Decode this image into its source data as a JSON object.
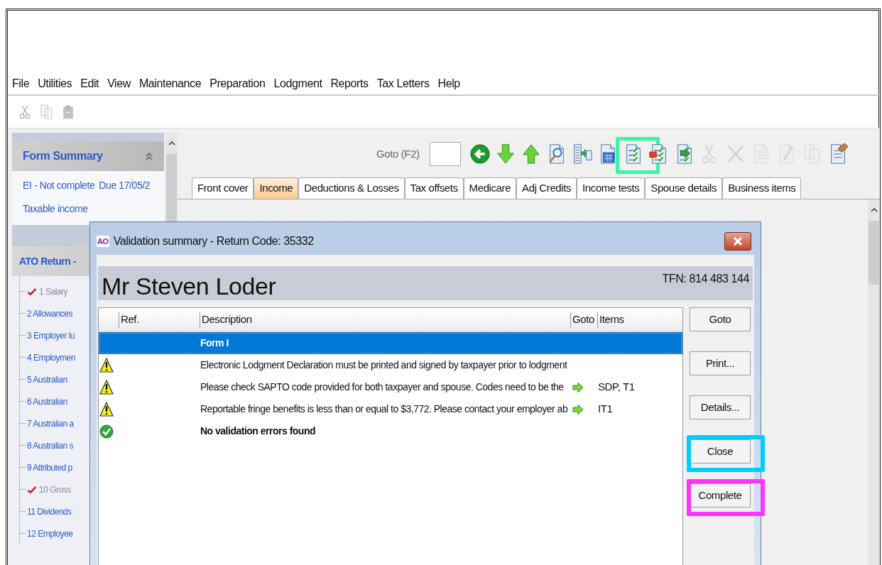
{
  "menu": [
    "File",
    "Utilities",
    "Edit",
    "View",
    "Maintenance",
    "Preparation",
    "Lodgment",
    "Reports",
    "Tax Letters",
    "Help"
  ],
  "edit_toolbar": [
    {
      "kind": "cut"
    },
    {
      "kind": "copy"
    },
    {
      "kind": "paste"
    }
  ],
  "sidebar": {
    "form_summary": {
      "title": "Form Summary",
      "status": "EI - Not complete",
      "due": "Due 17/05/2",
      "items": [
        "Taxable income"
      ]
    },
    "ato_return": {
      "title": "ATO Return -",
      "items": [
        {
          "label": "1 Salary",
          "checked": true
        },
        {
          "label": "2 Allowances",
          "checked": false
        },
        {
          "label": "3 Employer lu",
          "checked": false
        },
        {
          "label": "4 Employmen",
          "checked": false
        },
        {
          "label": "5 Australian",
          "checked": false
        },
        {
          "label": "6 Australian",
          "checked": false
        },
        {
          "label": "7 Australian a",
          "checked": false
        },
        {
          "label": "8 Australian s",
          "checked": false
        },
        {
          "label": "9 Attributed p",
          "checked": false
        },
        {
          "label": "10 Gross",
          "checked": true
        },
        {
          "label": "11 Dividends",
          "checked": false
        },
        {
          "label": "12 Employee",
          "checked": false
        }
      ]
    }
  },
  "goto": {
    "label": "Goto (F2)"
  },
  "toolbar": [
    {
      "kind": "back",
      "disabled": false
    },
    {
      "kind": "down",
      "disabled": false
    },
    {
      "kind": "up",
      "disabled": false
    },
    {
      "kind": "preview",
      "disabled": false
    },
    {
      "kind": "import",
      "disabled": false
    },
    {
      "kind": "calculator",
      "disabled": false
    },
    {
      "kind": "validate",
      "disabled": false,
      "color": "#3cf5a0"
    },
    {
      "kind": "validate_flag",
      "disabled": false
    },
    {
      "kind": "export",
      "disabled": false
    },
    {
      "kind": "cut",
      "disabled": true
    },
    {
      "kind": "delete",
      "disabled": true
    },
    {
      "kind": "doc",
      "disabled": true
    },
    {
      "kind": "edit",
      "disabled": true
    },
    {
      "kind": "copy",
      "disabled": true
    },
    {
      "kind": "hand",
      "disabled": false
    }
  ],
  "tabs": [
    {
      "label": "Front cover",
      "selected": false
    },
    {
      "label": "Income",
      "selected": true
    },
    {
      "label": "Deductions & Losses",
      "selected": false
    },
    {
      "label": "Tax offsets",
      "selected": false
    },
    {
      "label": "Medicare",
      "selected": false
    },
    {
      "label": "Adj Credits",
      "selected": false
    },
    {
      "label": "Income tests",
      "selected": false
    },
    {
      "label": "Spouse details",
      "selected": false
    },
    {
      "label": "Business items",
      "selected": false
    }
  ],
  "dialog": {
    "app_badge": "AO",
    "title": "Validation summary - Return Code: 35332",
    "taxpayer": "Mr Steven Loder",
    "tfn": "TFN: 814 483 144",
    "columns": [
      "Ref.",
      "Description",
      "Goto",
      "Items"
    ],
    "rows": [
      {
        "kind": "group",
        "description": "Form I",
        "goto": false,
        "selected": true
      },
      {
        "kind": "warning",
        "description": "Electronic Lodgment Declaration must be printed and signed by taxpayer prior to lodgment",
        "goto": false,
        "selected": false
      },
      {
        "kind": "warning",
        "description": "Please check SAPTO code provided for both taxpayer and spouse. Codes need to be the",
        "goto": true,
        "items": "SDP, T1",
        "selected": false
      },
      {
        "kind": "warning",
        "description": "Reportable fringe benefits is less than or equal to $3,772. Please contact your employer ab",
        "goto": true,
        "items": "IT1",
        "selected": false
      },
      {
        "kind": "ok",
        "description": "No validation errors found",
        "goto": false,
        "selected": false
      }
    ],
    "buttons": [
      {
        "label": "Goto"
      },
      {
        "label": "Print..."
      },
      {
        "label": "Details..."
      },
      {
        "label": "Close",
        "color": "#00ccff"
      },
      {
        "label": "Complete",
        "color": "#ff33ff"
      }
    ]
  }
}
